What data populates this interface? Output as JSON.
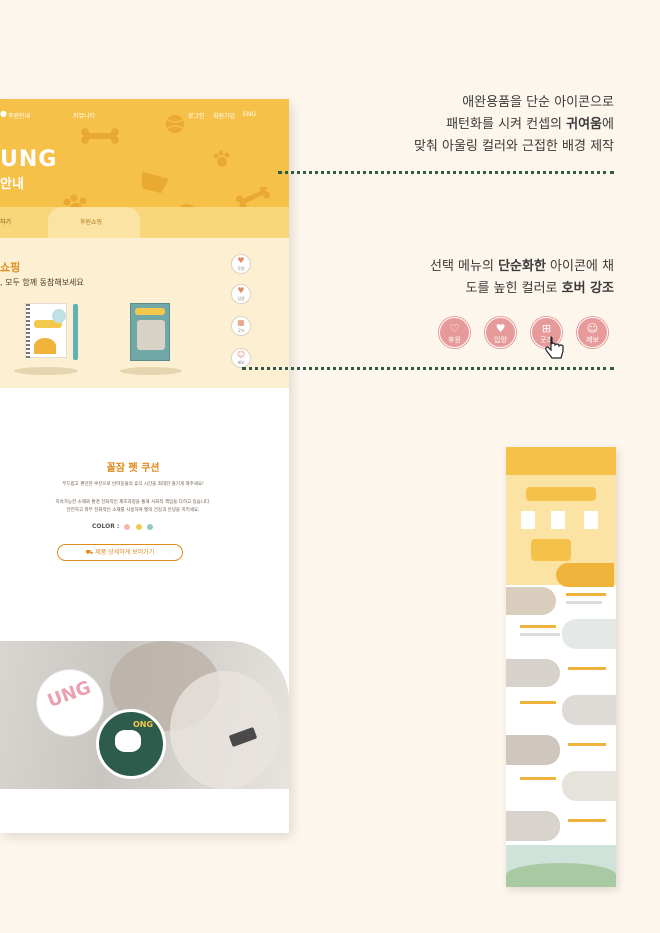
{
  "mockup": {
    "nav": {
      "item_guide": "후원안내",
      "item_community": "커뮤니티",
      "item_login": "로그인",
      "item_join": "회원가입",
      "item_lang": "ENG"
    },
    "hero": {
      "logo_text": "UNG",
      "subtitle": "안내"
    },
    "tabs": {
      "left": "하기",
      "right": "후원쇼핑"
    },
    "shop": {
      "title": "쇼핑",
      "description": ", 모두 함께 동참해보세요"
    },
    "side_menu": [
      {
        "label": "후원",
        "icon": "heart-hand-icon"
      },
      {
        "label": "입양",
        "icon": "heart-paw-icon"
      },
      {
        "label": "굿즈",
        "icon": "gift-icon"
      },
      {
        "label": "제보",
        "icon": "person-icon"
      }
    ],
    "coupon": {
      "title": "꼴잠 펫 쿠션",
      "line1": "부드럽고 편안한 쿠션으로 반려동물의 휴식 시간을 최대한 즐기게 해주세요!",
      "line2": "지속가능한 소재와 환경 친화적인 제조과정을 통해 사회적 책임을 다하고 있습니다.",
      "line3": "안전하고 파부 친화적인 소재를 사용하여 펫의 건강과 안녕을 지키세요.",
      "color_label": "COLOR :",
      "colors": [
        "#f2b8b0",
        "#f3c84e",
        "#8fc8c8"
      ],
      "cta": "제품 상세하게 보러가기"
    }
  },
  "annotations": {
    "block1": {
      "line1": "애완용품을 단순 아이콘으로",
      "line2_pre": "패턴화를 시켜 컨셉의 ",
      "line2_bold": "귀여움",
      "line2_post": "에",
      "line3": "맞춰 아울링 컬러와 근접한 배경 제작"
    },
    "block2": {
      "line1_pre": "선택 메뉴의 ",
      "line1_bold": "단순화한",
      "line1_post": " 아이콘에 채",
      "line2_pre": "도를 높힌 컬러로 ",
      "line2_bold": "호버 강조"
    },
    "hover_icons": [
      {
        "label": "후원",
        "icon": "heart-hand-icon"
      },
      {
        "label": "입양",
        "icon": "heart-paw-icon"
      },
      {
        "label": "굿즈",
        "icon": "gift-icon"
      },
      {
        "label": "제보",
        "icon": "person-icon"
      }
    ],
    "accent": "#e79a9a",
    "dotted_color": "#2f5a4a"
  },
  "colors": {
    "background": "#fdf6ec",
    "primary_yellow": "#f6c148",
    "accent_orange": "#e08b1e"
  }
}
